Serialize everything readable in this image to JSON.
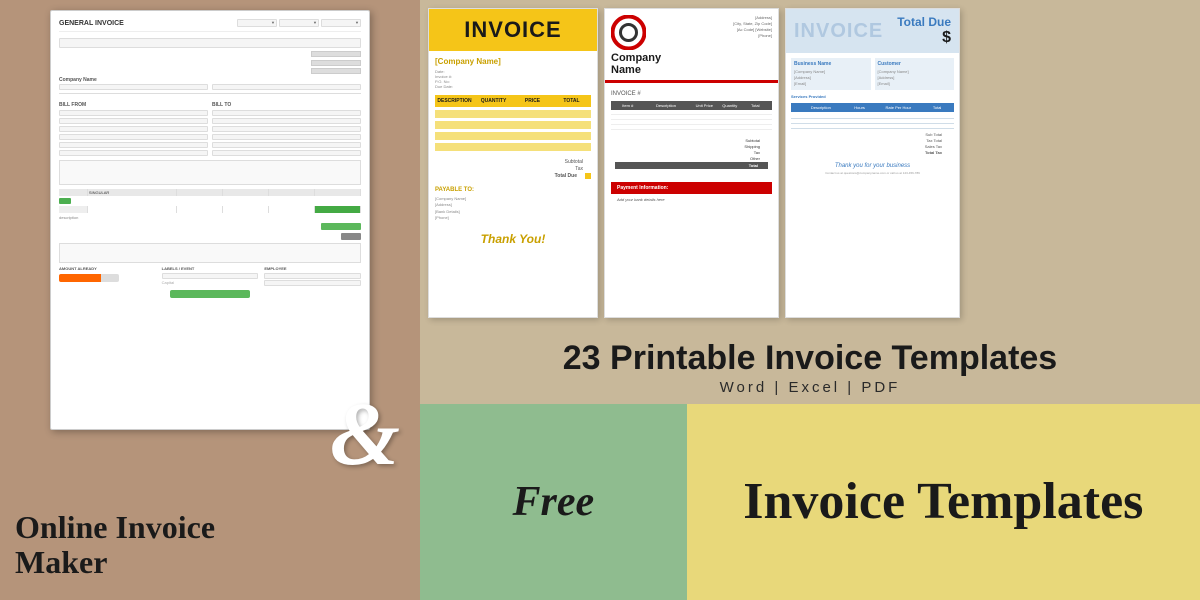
{
  "page": {
    "title": "Online Invoice Maker & 23 Printable Invoice Templates"
  },
  "left": {
    "heading_line1": "Online Invoice",
    "heading_line2": "Maker"
  },
  "ampersand": {
    "symbol": "&"
  },
  "invoice_yellow": {
    "title": "INVOICE",
    "company_name": "[Company Name]",
    "fields": "Date:\nInvoice #:\nP.O. No:\nDue Date:",
    "description_col": "DESCRIPTION",
    "quantity_col": "QUANTITY",
    "price_col": "PRICE",
    "total_col": "TOTAL",
    "subtotal_label": "Subtotal",
    "tax_label": "Tax",
    "total_due_label": "Total Due",
    "payable_to": "PAYABLE TO:",
    "payable_fields": "[Company Name]\n[Address]\n[Bank Details]\n[Phone]",
    "thankyou": "Thank You!"
  },
  "invoice_company": {
    "company_name": "Company\nName",
    "invoice_hash": "INVOICE #",
    "info_lines": "[Address]\n[City, State, Zip Code]\n[Ac Code] [Website]",
    "item_col": "Item #",
    "description_col": "Description",
    "unit_price_col": "Unit Price",
    "quantity_col": "Quantity",
    "total_col": "Total",
    "subtotal_label": "Subtotal",
    "shipping_label": "Shipping",
    "tax_label": "Tax",
    "other_label": "Other",
    "total_label": "Total",
    "payment_info": "Payment Information:",
    "payment_text": "Add your bank details here"
  },
  "invoice_blue": {
    "title": "INVOICE",
    "total_due_label": "Total Due",
    "dollar_sign": "$",
    "from_header": "Business Name",
    "customer_header": "Customer",
    "description_col": "Description",
    "hours_col": "Hours",
    "rate_col": "Rate Per Hour",
    "total_col": "Total",
    "subtotals": "Sub Total\nTax Total\nSales Tax\nTotal Tax",
    "thankyou": "Thank you for your business",
    "note": "Contact us at questions@companyname.com or call us at 123-456-789"
  },
  "right": {
    "printable_title": "23 Printable Invoice Templates",
    "printable_subtitle": "Word  |  Excel  |  PDF",
    "free_text": "Free",
    "invoice_templates_text": "Invoice Templates"
  },
  "colors": {
    "left_bg": "#b5947a",
    "right_bg": "#c8b89a",
    "yellow_accent": "#f5c518",
    "red_accent": "#cc0000",
    "blue_accent": "#3a7abf",
    "green_section": "#8fbc8f",
    "yellow_section": "#e8d87a"
  }
}
